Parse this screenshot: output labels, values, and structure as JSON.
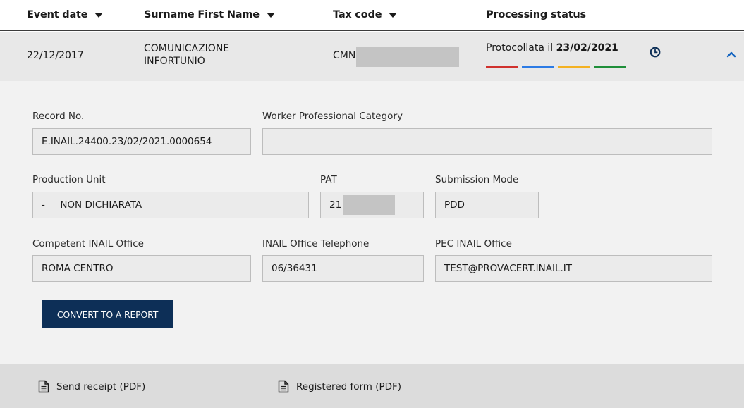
{
  "table_header": {
    "event_date": "Event date",
    "surname_first_name": "Surname First Name",
    "tax_code": "Tax code",
    "processing_status": "Processing status"
  },
  "row": {
    "event_date": "22/12/2017",
    "name_line1": "COMUNICAZIONE",
    "name_line2": "INFORTUNIO",
    "tax_code_prefix": "CMN",
    "status_prefix": "Protocollata il ",
    "status_date": "23/02/2021",
    "status_colors": [
      "#d0312d",
      "#2c7be5",
      "#f4b223",
      "#1f8f3a"
    ],
    "icons": [
      "clock-icon",
      "chevron-up-icon"
    ]
  },
  "details": {
    "record_no": {
      "label": "Record No.",
      "value": "E.INAIL.24400.23/02/2021.0000654"
    },
    "worker_category": {
      "label": "Worker Professional Category",
      "value": ""
    },
    "production_unit": {
      "label": "Production Unit",
      "value": "-     NON DICHIARATA"
    },
    "pat": {
      "label": "PAT",
      "value": "21"
    },
    "submission_mode": {
      "label": "Submission Mode",
      "value": "PDD"
    },
    "competent_office": {
      "label": "Competent INAIL Office",
      "value": "ROMA CENTRO"
    },
    "office_telephone": {
      "label": "INAIL Office Telephone",
      "value": "06/36431"
    },
    "pec_office": {
      "label": "PEC INAIL Office",
      "value": "TEST@PROVACERT.INAIL.IT"
    },
    "convert_button": "CONVERT TO A REPORT"
  },
  "footer": {
    "send_receipt": "Send receipt (PDF)",
    "registered_form": "Registered form (PDF)",
    "icons": [
      "document-icon"
    ]
  },
  "colors": {
    "header_border": "#3b3b3b",
    "row_background": "#e8e8e8",
    "panel_background": "#f2f2f2",
    "footer_background": "#dcdcdc",
    "button_background": "#0d2f57",
    "clock_icon": "#0d2f57",
    "chevron_icon": "#1565c0"
  }
}
